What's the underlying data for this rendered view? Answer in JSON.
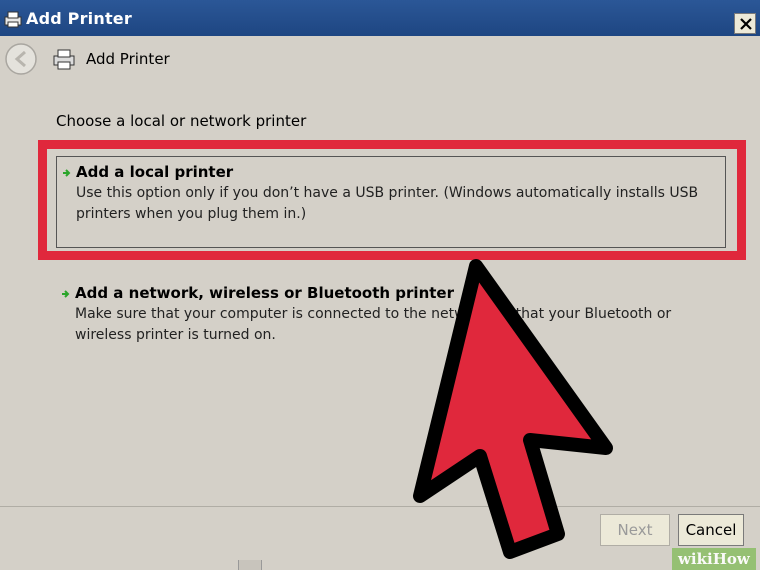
{
  "window": {
    "title": "Add Printer",
    "close_glyph": "✕"
  },
  "header": {
    "title": "Add Printer",
    "back_icon": "back-arrow-icon",
    "printer_icon": "printer-icon"
  },
  "main": {
    "heading": "Choose a local or network printer",
    "options": [
      {
        "title": "Add a local printer",
        "description": "Use this option only if you don’t have a USB printer. (Windows automatically installs USB printers when you plug them in.)"
      },
      {
        "title": "Add a network, wireless or Bluetooth printer",
        "description": "Make sure that your computer is connected to the network, or that your Bluetooth or wireless printer is turned on."
      }
    ]
  },
  "footer": {
    "next_label": "Next",
    "cancel_label": "Cancel"
  },
  "overlay": {
    "highlight_color": "#e0283c",
    "arrow_color": "#e0283c"
  },
  "watermark": {
    "text": "wikiHow"
  }
}
